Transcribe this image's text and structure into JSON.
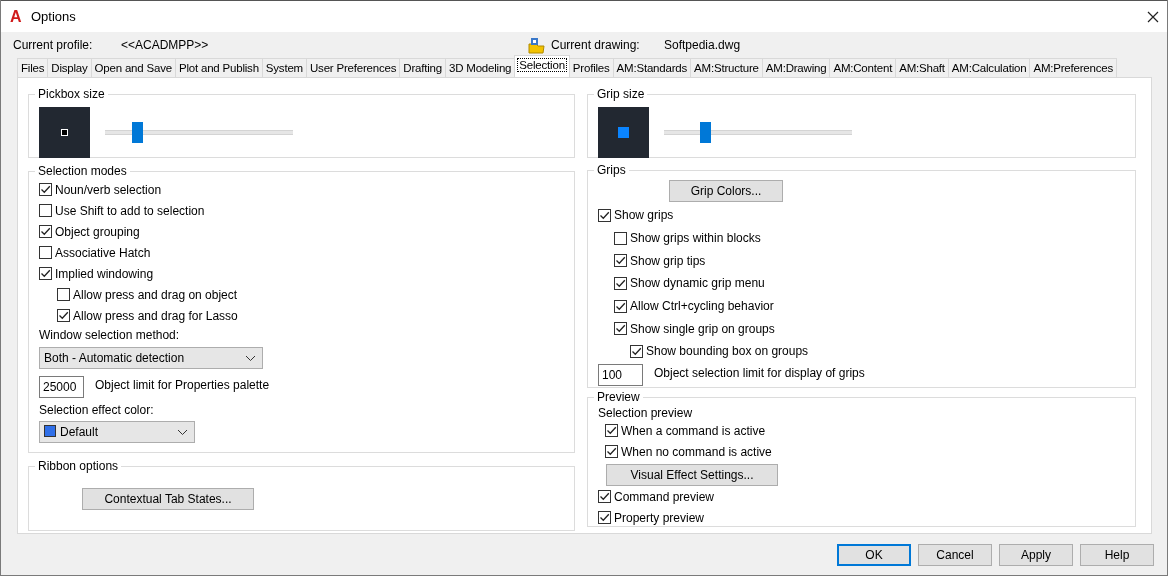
{
  "window": {
    "logo_letter": "A",
    "title": "Options"
  },
  "profile": {
    "label": "Current profile:",
    "value": "<<ACADMPP>>"
  },
  "drawing": {
    "label": "Current drawing:",
    "value": "Softpedia.dwg"
  },
  "tabs": [
    {
      "label": "Files",
      "selected": false
    },
    {
      "label": "Display",
      "selected": false
    },
    {
      "label": "Open and Save",
      "selected": false
    },
    {
      "label": "Plot and Publish",
      "selected": false
    },
    {
      "label": "System",
      "selected": false
    },
    {
      "label": "User Preferences",
      "selected": false
    },
    {
      "label": "Drafting",
      "selected": false
    },
    {
      "label": "3D Modeling",
      "selected": false
    },
    {
      "label": "Selection",
      "selected": true
    },
    {
      "label": "Profiles",
      "selected": false
    },
    {
      "label": "AM:Standards",
      "selected": false
    },
    {
      "label": "AM:Structure",
      "selected": false
    },
    {
      "label": "AM:Drawing",
      "selected": false
    },
    {
      "label": "AM:Content",
      "selected": false
    },
    {
      "label": "AM:Shaft",
      "selected": false
    },
    {
      "label": "AM:Calculation",
      "selected": false
    },
    {
      "label": "AM:Preferences",
      "selected": false
    }
  ],
  "pickbox": {
    "title": "Pickbox size",
    "level": 0.17
  },
  "selection_modes": {
    "title": "Selection modes",
    "options": [
      {
        "label": "Noun/verb selection",
        "checked": true
      },
      {
        "label": "Use Shift to add to selection",
        "checked": false
      },
      {
        "label": "Object grouping",
        "checked": true
      },
      {
        "label": "Associative Hatch",
        "checked": false
      },
      {
        "label": "Implied windowing",
        "checked": true,
        "children": [
          {
            "label": "Allow press and drag on object",
            "checked": false
          },
          {
            "label": "Allow press and drag for Lasso",
            "checked": true
          }
        ]
      }
    ],
    "window_method": {
      "label": "Window selection method:",
      "value": "Both - Automatic detection"
    },
    "object_limit": {
      "value": "25000",
      "label": "Object limit for Properties palette"
    },
    "effect_color": {
      "label": "Selection effect color:",
      "value": "Default"
    }
  },
  "ribbon": {
    "title": "Ribbon options",
    "button": "Contextual Tab States..."
  },
  "grip_size": {
    "title": "Grip size",
    "level": 0.22
  },
  "grips": {
    "title": "Grips",
    "button": "Grip Colors...",
    "options": [
      {
        "label": "Show grips",
        "checked": true,
        "children": [
          {
            "label": "Show grips within blocks",
            "checked": false
          },
          {
            "label": "Show grip tips",
            "checked": true
          },
          {
            "label": "Show dynamic grip menu",
            "checked": true
          },
          {
            "label": "Allow Ctrl+cycling behavior",
            "checked": true
          },
          {
            "label": "Show single grip on groups",
            "checked": true,
            "children": [
              {
                "label": "Show bounding box on groups",
                "checked": true
              }
            ]
          }
        ]
      }
    ],
    "limit": {
      "value": "100",
      "label": "Object selection limit for display of grips"
    }
  },
  "preview": {
    "title": "Preview",
    "subtitle": "Selection preview",
    "options": [
      {
        "label": "When a command is active",
        "checked": true
      },
      {
        "label": "When no command is active",
        "checked": true
      }
    ],
    "button": "Visual Effect Settings...",
    "more_options": [
      {
        "label": "Command preview",
        "checked": true
      },
      {
        "label": "Property preview",
        "checked": true
      }
    ]
  },
  "buttons": [
    {
      "label": "OK",
      "default": true
    },
    {
      "label": "Cancel",
      "default": false
    },
    {
      "label": "Apply",
      "default": false
    },
    {
      "label": "Help",
      "default": false
    }
  ]
}
